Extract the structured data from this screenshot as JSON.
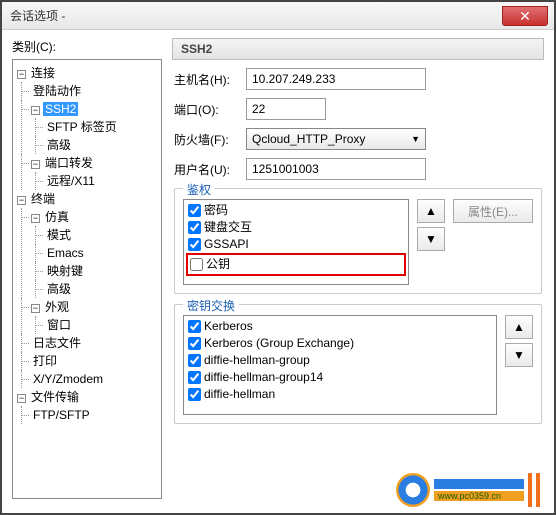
{
  "window": {
    "title": "会话选项 - "
  },
  "sidebar": {
    "label": "类别(C):",
    "tree": {
      "conn": "连接",
      "login": "登陆动作",
      "ssh2": "SSH2",
      "sftp": "SFTP 标签页",
      "adv1": "高级",
      "portfwd": "端口转发",
      "remote": "远程/X11",
      "term": "终端",
      "emu": "仿真",
      "mode": "模式",
      "emacs": "Emacs",
      "mapkey": "映射键",
      "adv2": "高级",
      "look": "外观",
      "window": "窗口",
      "logfile": "日志文件",
      "print": "打印",
      "xyz": "X/Y/Zmodem",
      "ft": "文件传输",
      "ftp": "FTP/SFTP"
    }
  },
  "panel": {
    "title": "SSH2",
    "host_label": "主机名(H):",
    "host": "10.207.249.233",
    "port_label": "端口(O):",
    "port": "22",
    "fw_label": "防火墙(F):",
    "fw": "Qcloud_HTTP_Proxy",
    "user_label": "用户名(U):",
    "user": "1251001003"
  },
  "auth": {
    "legend": "鉴权",
    "items": {
      "pw": "密码",
      "kb": "键盘交互",
      "gss": "GSSAPI",
      "pk": "公钥"
    },
    "prop_btn": "属性(E)..."
  },
  "kex": {
    "legend": "密钥交换",
    "items": {
      "k1": "Kerberos",
      "k2": "Kerberos (Group Exchange)",
      "k3": "diffie-hellman-group",
      "k4": "diffie-hellman-group14",
      "k5": "diffie-hellman"
    }
  },
  "watermark": "www.pc0359.cn"
}
